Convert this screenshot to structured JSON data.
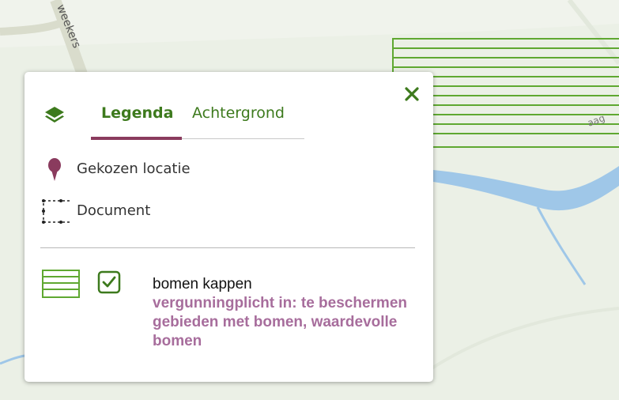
{
  "map": {
    "street_label": "weekers",
    "area_label": "aag",
    "colors": {
      "land": "#ebf0e6",
      "water": "#9fc7e8",
      "road": "#d9dccc",
      "hatch": "#5fa831"
    }
  },
  "legend_panel": {
    "close_icon": "close-icon",
    "layers_icon": "layers-icon",
    "tabs": [
      {
        "label": "Legenda",
        "active": true
      },
      {
        "label": "Achtergrond",
        "active": false
      }
    ],
    "items": [
      {
        "icon": "location-pin-icon",
        "label": "Gekozen locatie"
      },
      {
        "icon": "document-outline-icon",
        "label": "Document"
      }
    ],
    "feature": {
      "icon": "hatched-area-icon",
      "checked": true,
      "title": "bomen kappen",
      "description": "vergunningplicht in: te beschermen gebieden met bomen, waardevolle bomen"
    },
    "colors": {
      "accent_green": "#3d7a1d",
      "tab_underline": "#8a3b5e",
      "pin": "#8a3b5e",
      "description": "#a76d9c"
    }
  }
}
